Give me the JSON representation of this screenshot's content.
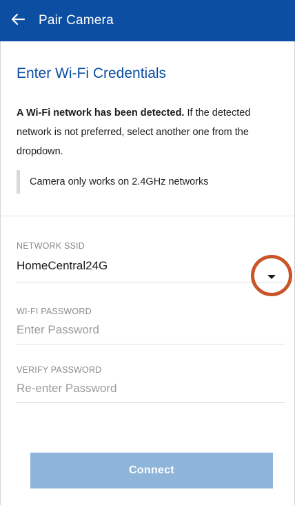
{
  "appbar": {
    "title": "Pair Camera",
    "back_icon": "arrow-left-icon",
    "color": "#0b4ea2"
  },
  "main": {
    "heading": "Enter Wi-Fi Credentials",
    "description_bold": "A Wi-Fi network has been detected.",
    "description_rest": " If the detected network is not preferred, select another one from the dropdown.",
    "note": "Camera only works on 2.4GHz networks"
  },
  "form": {
    "ssid": {
      "label": "NETWORK SSID",
      "value": "HomeCentral24G",
      "dropdown_icon": "caret-down-icon"
    },
    "password": {
      "label": "WI-FI PASSWORD",
      "placeholder": "Enter Password"
    },
    "verify": {
      "label": "VERIFY PASSWORD",
      "placeholder": "Re-enter Password"
    }
  },
  "actions": {
    "connect_label": "Connect",
    "connect_color": "#8fb4da"
  },
  "annotation": {
    "highlight_color": "#c9562b"
  }
}
